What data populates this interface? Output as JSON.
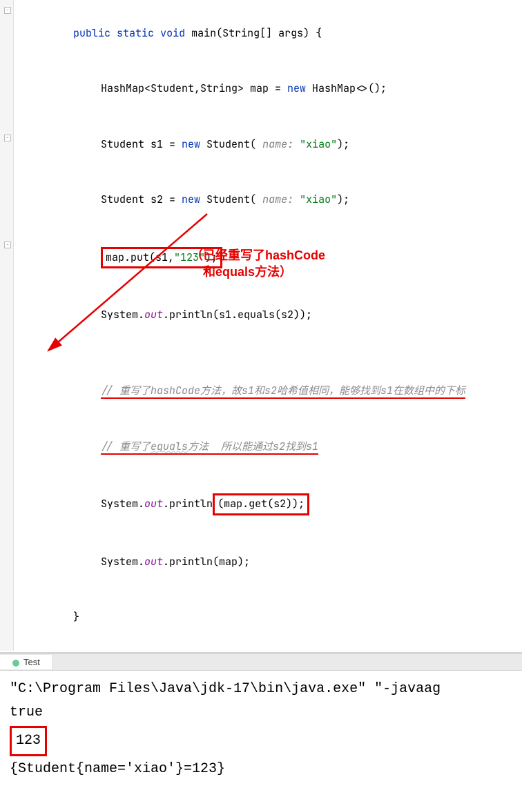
{
  "code": {
    "line1_kw_public": "public",
    "line1_kw_static": "static",
    "line1_kw_void": "void",
    "line1_method": "main",
    "line1_params": "(String[] args) {",
    "line2_a": "HashMap<Student,String> map = ",
    "line2_kw_new": "new",
    "line2_b": " HashMap<>();",
    "line3_a": "Student s1 = ",
    "line3_kw_new": "new",
    "line3_b": " Student( ",
    "line3_param": "name: ",
    "line3_str": "\"xiao\"",
    "line3_c": ");",
    "line4_a": "Student s2 = ",
    "line4_kw_new": "new",
    "line4_b": " Student( ",
    "line4_param": "name: ",
    "line4_str": "\"xiao\"",
    "line4_c": ");",
    "line5_a": "map.put(s1,",
    "line5_str": "\"123\"",
    "line5_b": ");",
    "line6_a": "System.",
    "line6_field": "out",
    "line6_b": ".println(s1.equals(s2));",
    "comment1": "// 重写了hashCode方法，故s1和s2哈希值相同，能够找到s1在数组中的下标",
    "comment2_a": "// 重写了",
    "comment2_b": "equals",
    "comment2_c": "方法  所以能通过s2找到s1",
    "line9_a": "System.",
    "line9_field": "out",
    "line9_b": ".println",
    "line9_box": "(map.get(s2));",
    "line10_a": "System.",
    "line10_field": "out",
    "line10_b": ".println(map);",
    "line11": "}"
  },
  "annotation": {
    "line1": "（已经重写了hashCode",
    "line2": "和equals方法）"
  },
  "tab": {
    "label": "Test"
  },
  "console": {
    "line1": "\"C:\\Program Files\\Java\\jdk-17\\bin\\java.exe\" \"-javaag",
    "line2": "true",
    "line3": "123",
    "line4": "{Student{name='xiao'}=123}"
  }
}
